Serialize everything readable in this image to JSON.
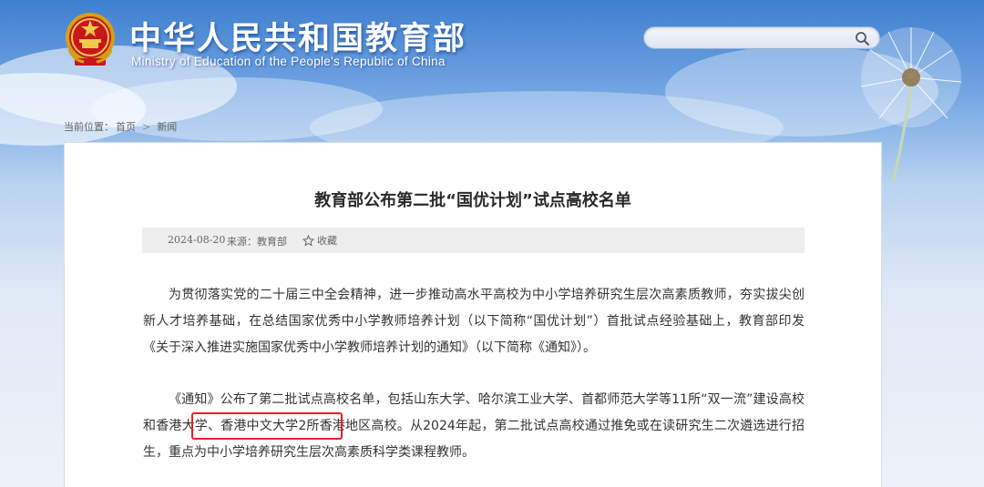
{
  "header": {
    "title": "中华人民共和国教育部",
    "subtitle": "Ministry of Education of the People's Republic of China",
    "emblem_icon": "national-emblem-icon"
  },
  "search": {
    "value": "",
    "placeholder": "",
    "icon": "search-icon"
  },
  "breadcrumb": {
    "label": "当前位置：",
    "items": [
      "首页",
      "新闻"
    ],
    "separator": ">"
  },
  "article": {
    "title": "教育部公布第二批“国优计划”试点高校名单",
    "date": "2024-08-20",
    "source_label": "来源：",
    "source": "教育部",
    "favorite_label": "收藏",
    "paragraphs": [
      "为贯彻落实党的二十届三中全会精神，进一步推动高水平高校为中小学培养研究生层次高素质教师，夯实拔尖创新人才培养基础，在总结国家优秀中小学教师培养计划（以下简称“国优计划”）首批试点经验基础上，教育部印发《关于深入推进实施国家优秀中小学教师培养计划的通知》（以下简称《通知》）。",
      "《通知》公布了第二批试点高校名单，包括山东大学、哈尔滨工业大学、首都师范大学等11所“双一流”建设高校和香港大学、香港中文大学2所香港地区高校。从2024年起，第二批试点高校通过推免或在读研究生二次遴选进行招生，重点为中小学培养研究生层次高素质科学类课程教师。"
    ]
  },
  "colors": {
    "highlight": "#e4202a",
    "header_sky": "#3f7fd0",
    "title_text": "#ffffff"
  }
}
